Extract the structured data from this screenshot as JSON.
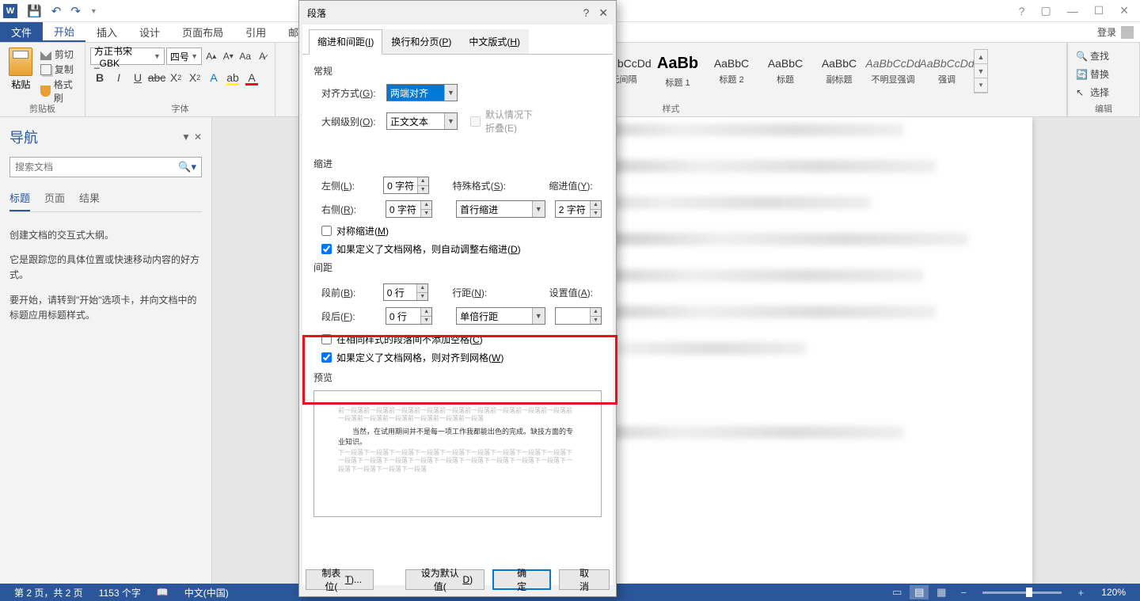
{
  "titlebar": {
    "help": "?",
    "login": "登录"
  },
  "ribbonTabs": {
    "file": "文件",
    "home": "开始",
    "insert": "插入",
    "design": "设计",
    "layout": "页面布局",
    "references": "引用",
    "mail": "邮"
  },
  "clipboard": {
    "paste": "粘贴",
    "cut": "剪切",
    "copy": "复制",
    "formatPainter": "格式刷",
    "groupLabel": "剪贴板"
  },
  "font": {
    "name": "方正书宋_GBK",
    "size": "四号",
    "groupLabel": "字体"
  },
  "styles": {
    "groupLabel": "样式",
    "items": [
      {
        "preview": "AaBbCcDd",
        "name": "无间隔",
        "cls": ""
      },
      {
        "preview": "AaBb",
        "name": "标题 1",
        "cls": "heading1"
      },
      {
        "preview": "AaBbC",
        "name": "标题 2",
        "cls": ""
      },
      {
        "preview": "AaBbC",
        "name": "标题",
        "cls": ""
      },
      {
        "preview": "AaBbC",
        "name": "副标题",
        "cls": ""
      },
      {
        "preview": "AaBbCcDd",
        "name": "不明显强调",
        "cls": "italic"
      },
      {
        "preview": "AaBbCcDd",
        "name": "强调",
        "cls": "italic"
      }
    ]
  },
  "editing": {
    "find": "查找",
    "replace": "替换",
    "select": "选择",
    "groupLabel": "编辑"
  },
  "nav": {
    "title": "导航",
    "searchPlaceholder": "搜索文档",
    "tabs": {
      "headings": "标题",
      "pages": "页面",
      "results": "结果"
    },
    "text1": "创建文档的交互式大纲。",
    "text2": "它是跟踪您的具体位置或快速移动内容的好方式。",
    "text3": "要开始，请转到\"开始\"选项卡，并向文档中的标题应用标题样式。"
  },
  "dialog": {
    "title": "段落",
    "tabs": {
      "indent": "缩进和间距(I)",
      "page": "换行和分页(P)",
      "chinese": "中文版式(H)"
    },
    "general": "常规",
    "alignment": {
      "label": "对齐方式(G):",
      "value": "两端对齐"
    },
    "outline": {
      "label": "大纲级别(O):",
      "value": "正文文本"
    },
    "collapse": "默认情况下折叠(E)",
    "indent": "缩进",
    "left": {
      "label": "左侧(L):",
      "value": "0 字符"
    },
    "right": {
      "label": "右侧(R):",
      "value": "0 字符"
    },
    "special": {
      "label": "特殊格式(S):",
      "value": "首行缩进"
    },
    "indentBy": {
      "label": "缩进值(Y):",
      "value": "2 字符"
    },
    "mirror": "对称缩进(M)",
    "autoAdjust": "如果定义了文档网格，则自动调整右缩进(D)",
    "spacing": "间距",
    "before": {
      "label": "段前(B):",
      "value": "0 行"
    },
    "after": {
      "label": "段后(F):",
      "value": "0 行"
    },
    "lineSpacing": {
      "label": "行距(N):",
      "value": "单倍行距"
    },
    "setAt": {
      "label": "设置值(A):",
      "value": ""
    },
    "noSpace": "在相同样式的段落间不添加空格(C)",
    "snapGrid": "如果定义了文档网格，则对齐到网格(W)",
    "preview": "预览",
    "previewSample": "当然，在试用期间并不是每一项工作我都能出色的完成。缺技方面的专业知识。",
    "tabsBtn": "制表位(T)...",
    "defaultBtn": "设为默认值(D)",
    "ok": "确定",
    "cancel": "取消"
  },
  "statusbar": {
    "page": "第 2 页，共 2 页",
    "words": "1153 个字",
    "language": "中文(中国)",
    "zoom": "120%"
  }
}
